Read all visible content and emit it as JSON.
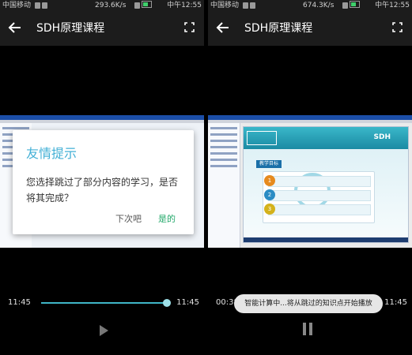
{
  "left": {
    "status": {
      "carrier": "中国移动",
      "network_speed": "293.6K/s",
      "time": "中午12:55"
    },
    "header": {
      "title": "SDH原理课程"
    },
    "dialog": {
      "title": "友情提示",
      "message": "您选择跳过了部分内容的学习，是否将其完成？",
      "later_label": "下次吧",
      "confirm_label": "是的"
    },
    "player": {
      "current_time": "11:45",
      "total_time": "11:45",
      "progress_percent": 100
    }
  },
  "right": {
    "status": {
      "carrier": "中国移动",
      "network_speed": "674.3K/s",
      "time": "中午12:55"
    },
    "header": {
      "title": "SDH原理课程"
    },
    "slide": {
      "logo_text": "SDH",
      "section_label": "教学目标",
      "goals": [
        "1",
        "2",
        "3"
      ]
    },
    "toast": {
      "text": "智能计算中...将从跳过的知识点开始播放"
    },
    "player": {
      "current_time": "00:38",
      "total_time": "11:45",
      "progress_percent": 5
    }
  },
  "icons": {
    "back": "back-arrow-icon",
    "fullscreen": "fullscreen-icon",
    "play": "play-icon",
    "pause": "pause-icon",
    "battery": "battery-icon"
  },
  "colors": {
    "accent": "#3fb6c7",
    "dialog_title": "#43b0d6",
    "confirm": "#23a86a"
  }
}
